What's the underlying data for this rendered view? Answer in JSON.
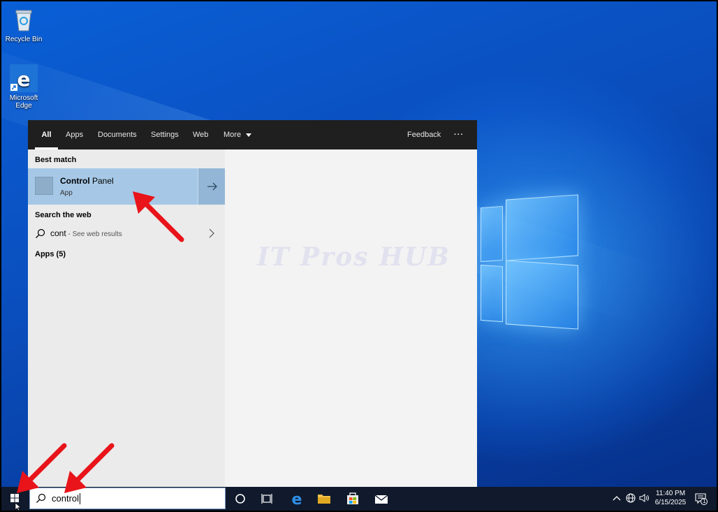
{
  "desktop": {
    "icons": [
      {
        "label": "Recycle Bin"
      },
      {
        "label": "Microsoft Edge"
      }
    ]
  },
  "search_panel": {
    "tabs": [
      {
        "label": "All",
        "active": true
      },
      {
        "label": "Apps"
      },
      {
        "label": "Documents"
      },
      {
        "label": "Settings"
      },
      {
        "label": "Web"
      },
      {
        "label": "More"
      }
    ],
    "feedback_label": "Feedback",
    "more_options_label": "···",
    "best_match_heading": "Best match",
    "best_match": {
      "name_bold": "Control",
      "name_rest": " Panel",
      "type": "App"
    },
    "search_web_heading": "Search the web",
    "web_result": {
      "query": "cont",
      "suffix": " - See web results"
    },
    "apps_heading": "Apps (5)",
    "watermark": "IT Pros HUB"
  },
  "taskbar": {
    "search_value": "control",
    "clock_time": "11:40 PM",
    "clock_date": "6/15/2025",
    "notification_count": "1"
  },
  "colors": {
    "accent_selected": "#a6c8e6",
    "taskbar": "#101a2c",
    "annotation_arrow": "#e8141a"
  }
}
